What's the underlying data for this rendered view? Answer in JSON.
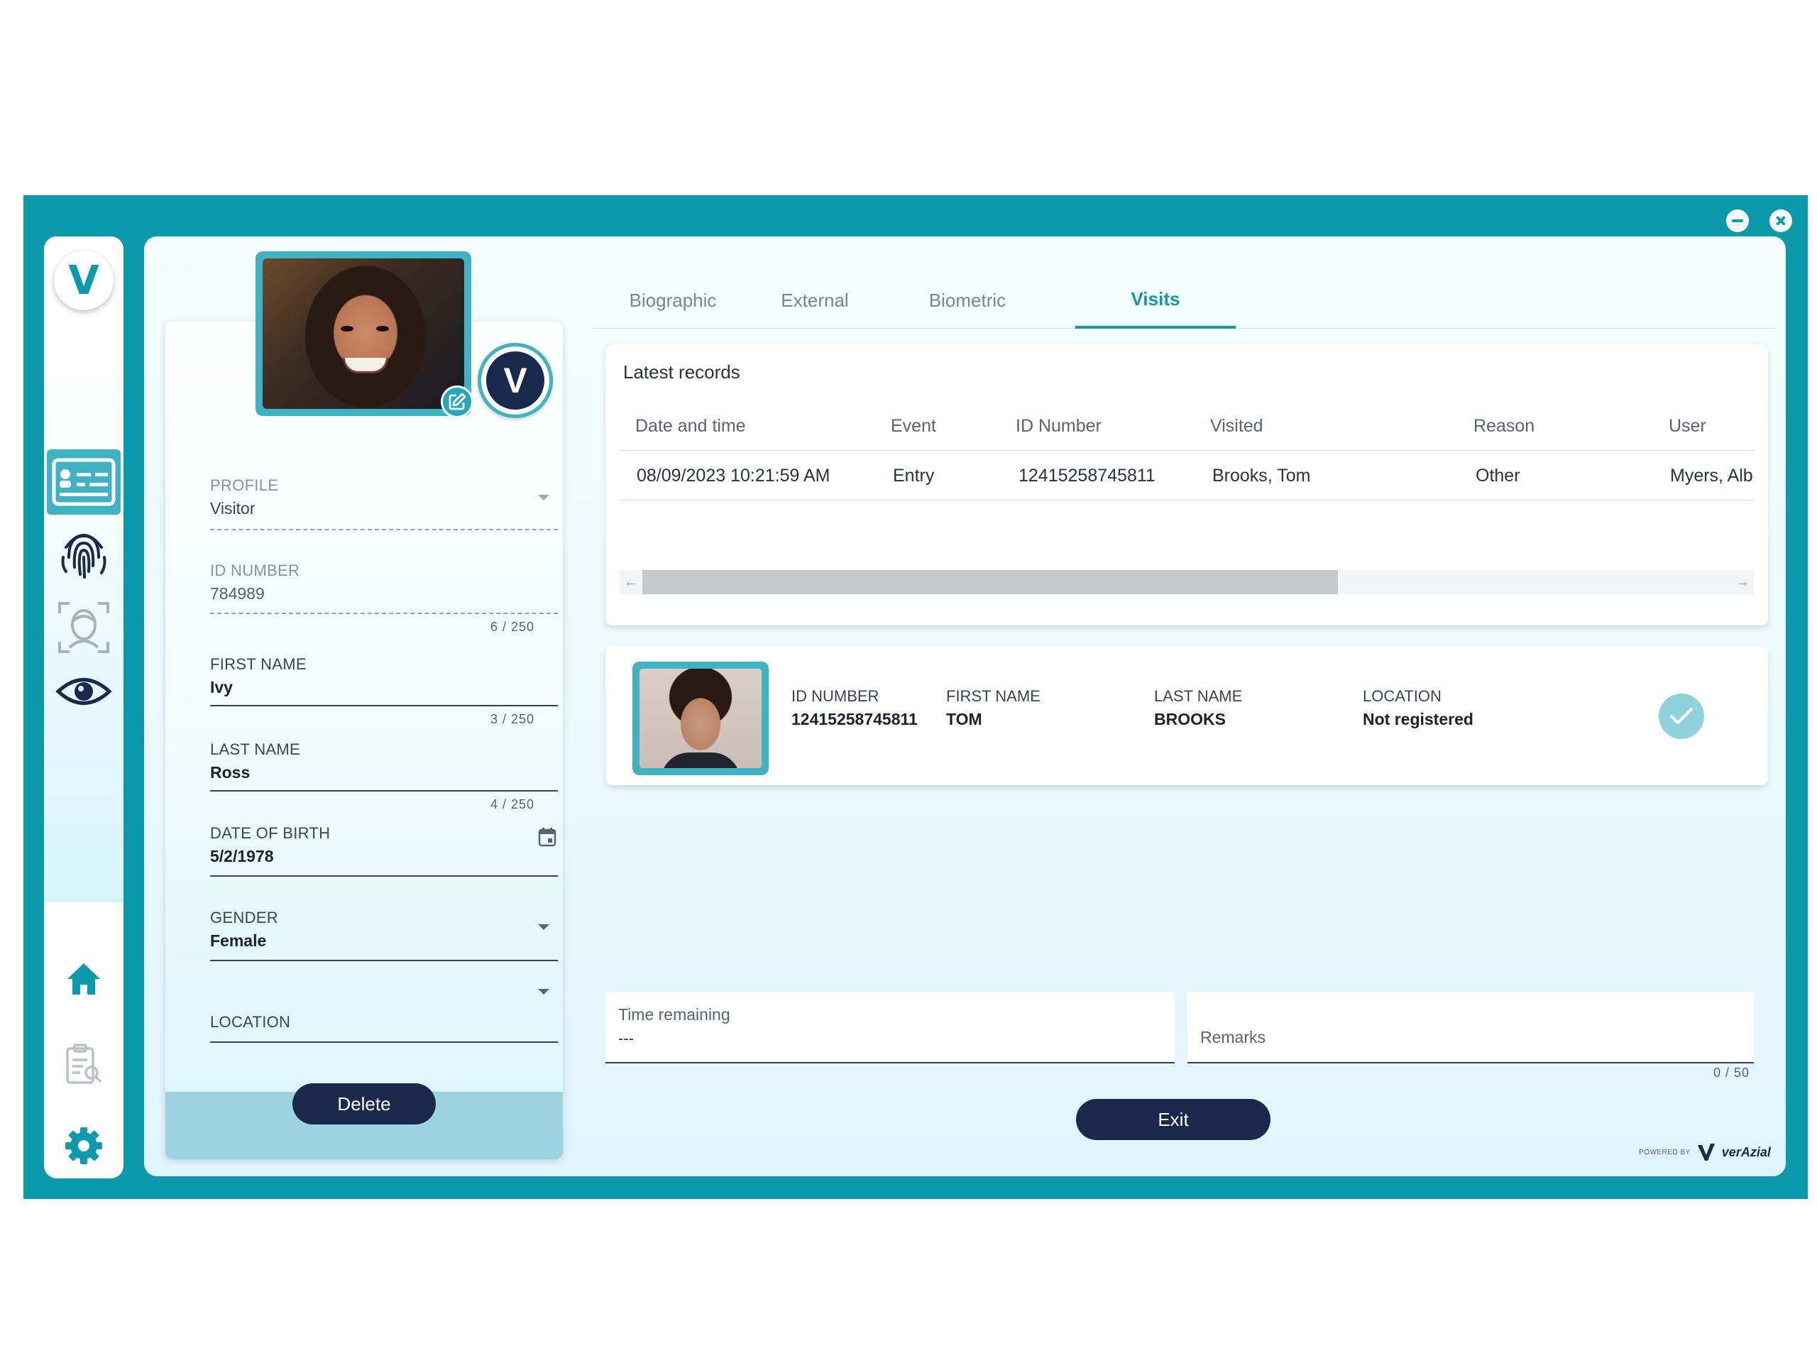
{
  "window": {
    "minimize_label": "minimize",
    "close_label": "close"
  },
  "sidebar": {
    "logo": "V",
    "items": [
      {
        "name": "id-card",
        "icon": "id-card-icon",
        "active": true
      },
      {
        "name": "fingerprint",
        "icon": "fingerprint-icon",
        "active": false
      },
      {
        "name": "face-scan",
        "icon": "face-scan-icon",
        "active": false
      },
      {
        "name": "iris",
        "icon": "eye-icon",
        "active": false
      },
      {
        "name": "home",
        "icon": "home-icon",
        "active": false
      },
      {
        "name": "reports",
        "icon": "clipboard-search-icon",
        "active": false
      },
      {
        "name": "settings",
        "icon": "gear-icon",
        "active": false
      }
    ]
  },
  "profile": {
    "badge_letter": "V",
    "fields": {
      "profile": {
        "label": "PROFILE",
        "value": "Visitor"
      },
      "id_number": {
        "label": "ID NUMBER",
        "value": "784989",
        "counter": "6 / 250"
      },
      "first_name": {
        "label": "FIRST NAME",
        "value": "Ivy",
        "counter": "3 / 250"
      },
      "last_name": {
        "label": "LAST NAME",
        "value": "Ross",
        "counter": "4 / 250"
      },
      "date_of_birth": {
        "label": "DATE OF BIRTH",
        "value": "5/2/1978"
      },
      "gender": {
        "label": "GENDER",
        "value": "Female"
      },
      "location": {
        "label": "LOCATION",
        "value": ""
      }
    },
    "delete_label": "Delete"
  },
  "tabs": [
    {
      "label": "Biographic",
      "active": false
    },
    {
      "label": "External",
      "active": false
    },
    {
      "label": "Biometric",
      "active": false
    },
    {
      "label": "Visits",
      "active": true
    }
  ],
  "records": {
    "title": "Latest records",
    "columns": [
      "Date and time",
      "Event",
      "ID Number",
      "Visited",
      "Reason",
      "User"
    ],
    "rows": [
      [
        "08/09/2023 10:21:59 AM",
        "Entry",
        "12415258745811",
        "Brooks, Tom",
        "Other",
        "Myers, Alb"
      ]
    ],
    "scroll_left": "←",
    "scroll_right": "→"
  },
  "visited": {
    "id_number": {
      "label": "ID NUMBER",
      "value": "12415258745811"
    },
    "first_name": {
      "label": "FIRST NAME",
      "value": "TOM"
    },
    "last_name": {
      "label": "LAST NAME",
      "value": "BROOKS"
    },
    "location": {
      "label": "LOCATION",
      "value": "Not registered"
    },
    "status_icon": "check-icon"
  },
  "time_remaining": {
    "label": "Time remaining",
    "value": "---"
  },
  "remarks": {
    "label": "Remarks",
    "counter": "0 / 50"
  },
  "exit_label": "Exit",
  "powered_by": {
    "prefix": "POWERED BY",
    "brand": "verAzial"
  },
  "colors": {
    "frame": "#0b9aab",
    "accent": "#1398aa",
    "dark_button": "#1b2a4a"
  }
}
